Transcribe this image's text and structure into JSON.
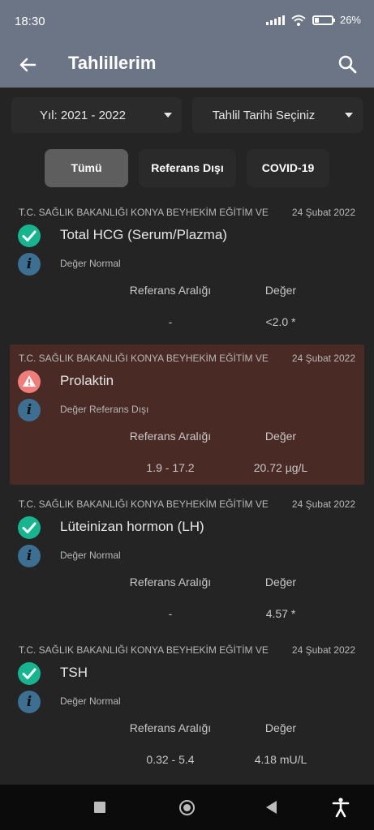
{
  "status_bar": {
    "time": "18:30",
    "battery": "26%",
    "battery_fill": 0.26
  },
  "app_bar": {
    "title": "Tahlillerim",
    "back_icon": "arrow-back-icon",
    "search_icon": "search-icon"
  },
  "filters": {
    "year": "Yıl: 2021 - 2022",
    "date": "Tahlil Tarihi Seçiniz"
  },
  "chips": [
    "Tümü",
    "Referans Dışı",
    "COVID-19"
  ],
  "columns": {
    "range": "Referans Aralığı",
    "value": "Değer"
  },
  "results": [
    {
      "hospital": "T.C. SAĞLIK BAKANLIĞI KONYA BEYHEKİM EĞİTİM VE",
      "date": "24 Şubat 2022",
      "name": "Total HCG (Serum/Plazma)",
      "status": "Değer Normal",
      "range": "-",
      "value": "<2.0 *",
      "icon": "check-icon"
    },
    {
      "hospital": "T.C. SAĞLIK BAKANLIĞI KONYA BEYHEKİM EĞİTİM VE",
      "date": "24 Şubat 2022",
      "name": "Prolaktin",
      "status": "Değer Referans Dışı",
      "range": "1.9 - 17.2",
      "value": "20.72 µg/L",
      "icon": "warning-icon"
    },
    {
      "hospital": "T.C. SAĞLIK BAKANLIĞI KONYA BEYHEKİM EĞİTİM VE",
      "date": "24 Şubat 2022",
      "name": "Lüteinizan hormon (LH)",
      "status": "Değer Normal",
      "range": "-",
      "value": "4.57 *",
      "icon": "check-icon"
    },
    {
      "hospital": "T.C. SAĞLIK BAKANLIĞI KONYA BEYHEKİM EĞİTİM VE",
      "date": "24 Şubat 2022",
      "name": "TSH",
      "status": "Değer Normal",
      "range": "0.32 - 5.4",
      "value": "4.18 mU/L",
      "icon": "check-icon"
    }
  ],
  "colors": {
    "app_bar": "#6c7585",
    "background": "#242424",
    "ok": "#16b590",
    "warn": "#f07c7b",
    "alert_card": "#4a2a25",
    "info": "#3d6f92"
  }
}
